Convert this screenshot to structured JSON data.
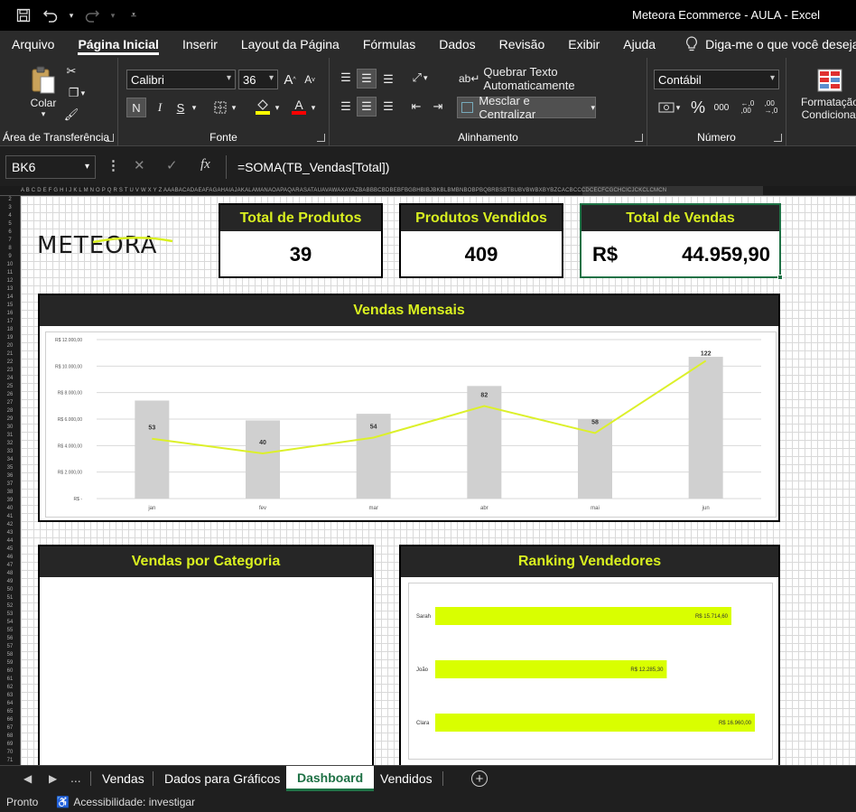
{
  "window": {
    "title": "Meteora Ecommerce - AULA  -  Excel"
  },
  "quick_access": {
    "save": "save-icon",
    "undo": "undo-icon",
    "redo": "redo-icon",
    "customize": "customize-icon"
  },
  "menu": {
    "tabs": [
      "Arquivo",
      "Página Inicial",
      "Inserir",
      "Layout da Página",
      "Fórmulas",
      "Dados",
      "Revisão",
      "Exibir",
      "Ajuda"
    ],
    "active": "Página Inicial",
    "tell_me": "Diga-me o que você deseja fazer"
  },
  "ribbon": {
    "clipboard": {
      "paste_label": "Colar",
      "group_label": "Área de Transferência"
    },
    "font": {
      "name": "Calibri",
      "size": "36",
      "bold": "N",
      "italic": "I",
      "underline": "S",
      "group_label": "Fonte",
      "fill_color": "#ffff00",
      "font_color": "#ff0000"
    },
    "alignment": {
      "wrap_text": "Quebrar Texto Automaticamente",
      "merge_center": "Mesclar e Centralizar",
      "group_label": "Alinhamento"
    },
    "number": {
      "format": "Contábil",
      "percent": "%",
      "thousands": "000",
      "group_label": "Número"
    },
    "styles": {
      "conditional_line1": "Formatação",
      "conditional_line2": "Condicional"
    }
  },
  "formula_bar": {
    "name_box": "BK6",
    "formula": "=SOMA(TB_Vendas[Total])",
    "fx": "fx"
  },
  "grid": {
    "columns": "A B C D E F G H I J K L M N O P Q R S T U V W X Y Z AAABACADAEAFAGAHAIAJAKALAMANAOAPAQARASATAUAVAWAXAYAZBABBBCBDBEBFBGBHBIBJBKBLBMBNBOBPBQBRBSBTBUBVBWBXBYBZCACBCCCDCECFCGCHCICJCKCLCMCN",
    "rows": 71
  },
  "dashboard": {
    "logo_text": "METEORA",
    "kpis": [
      {
        "title": "Total de Produtos",
        "value": "39"
      },
      {
        "title": "Produtos  Vendidos",
        "value": "409"
      },
      {
        "title": "Total de Vendas",
        "currency": "R$",
        "value": "44.959,90"
      }
    ],
    "monthly_title": "Vendas Mensais",
    "category_title": "Vendas por Categoria",
    "ranking_title": "Ranking Vendedores"
  },
  "chart_data": [
    {
      "type": "bar",
      "title": "Vendas Mensais",
      "categories": [
        "jan",
        "fev",
        "mar",
        "abr",
        "mai",
        "jun"
      ],
      "series": [
        {
          "type": "bar",
          "values": [
            7400,
            5900,
            6400,
            8500,
            6000,
            10700
          ]
        },
        {
          "type": "line",
          "values": [
            53,
            40,
            54,
            82,
            58,
            122
          ],
          "color": "#dcf02a"
        }
      ],
      "y_ticks": [
        "R$ -",
        "R$ 2.000,00",
        "R$ 4.000,00",
        "R$ 6.000,00",
        "R$ 8.000,00",
        "R$ 10.000,00",
        "R$ 12.000,00"
      ],
      "ylim": [
        0,
        12000
      ],
      "bar_color": "#d0d0d0",
      "grid": true
    },
    {
      "type": "bar",
      "orientation": "horizontal",
      "title": "Ranking Vendedores",
      "categories": [
        "Sarah",
        "João",
        "Clara"
      ],
      "values": [
        15714.6,
        12285.3,
        16960.0
      ],
      "value_labels": [
        "R$ 15.714,60",
        "R$ 12.285,30",
        "R$ 16.960,00"
      ],
      "bar_color": "#d9ff00"
    }
  ],
  "sheet_tabs": {
    "nav_more": "...",
    "tabs": [
      "Vendas",
      "Dados para Gráficos",
      "Dashboard",
      "Vendidos"
    ],
    "active": "Dashboard"
  },
  "status": {
    "ready": "Pronto",
    "accessibility": "Acessibilidade: investigar"
  }
}
